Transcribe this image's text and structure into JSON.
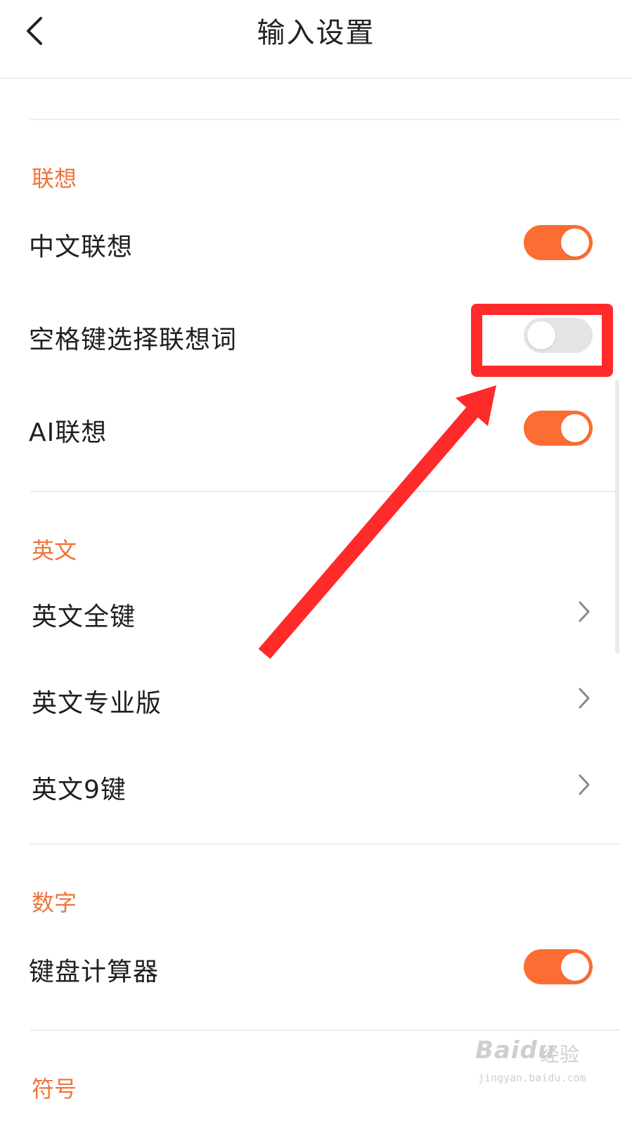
{
  "header": {
    "title": "输入设置"
  },
  "sections": {
    "association": {
      "title": "联想",
      "items": [
        {
          "label": "中文联想",
          "on": true
        },
        {
          "label": "空格键选择联想词",
          "on": false
        },
        {
          "label": "AI联想",
          "on": true
        }
      ]
    },
    "english": {
      "title": "英文",
      "items": [
        {
          "label": "英文全键"
        },
        {
          "label": "英文专业版"
        },
        {
          "label": "英文9键"
        }
      ]
    },
    "number": {
      "title": "数字",
      "items": [
        {
          "label": "键盘计算器",
          "on": true
        }
      ]
    },
    "symbol": {
      "title": "符号"
    }
  },
  "watermark": {
    "logo": "Baidu",
    "name": "经验",
    "url": "jingyan.baidu.com"
  },
  "colors": {
    "accent": "#fb6d33",
    "section_title": "#f0743a",
    "toggle_off": "#e4e5e7",
    "annotation": "#ff2a2a"
  },
  "icons": {
    "back": "chevron-left-icon",
    "row_arrow": "chevron-right-icon"
  }
}
